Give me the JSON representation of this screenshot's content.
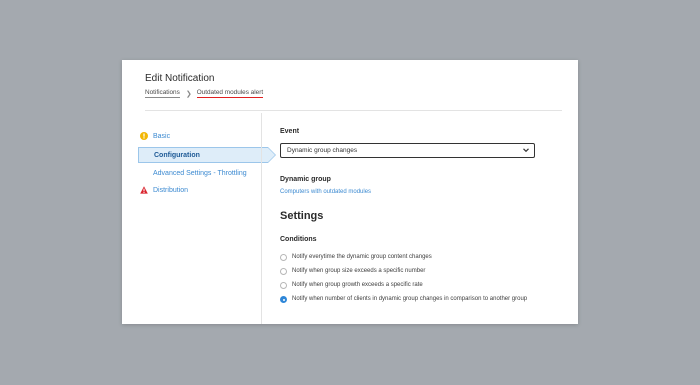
{
  "dialog": {
    "title": "Edit Notification",
    "breadcrumb": {
      "parent": "Notifications",
      "current": "Outdated modules alert"
    }
  },
  "sidebar": {
    "items": [
      {
        "label": "Basic",
        "icon": "warning-circle-icon",
        "icon_color": "#f2b705"
      },
      {
        "label": "Configuration",
        "active": true
      },
      {
        "label": "Advanced Settings - Throttling"
      },
      {
        "label": "Distribution",
        "icon": "error-triangle-icon",
        "icon_color": "#d9232d"
      }
    ]
  },
  "main": {
    "event_label": "Event",
    "event_select_value": "Dynamic group changes",
    "dynamic_group_label": "Dynamic group",
    "dynamic_group_value": "Computers with outdated modules",
    "settings_heading": "Settings",
    "conditions_label": "Conditions",
    "conditions": [
      {
        "label": "Notify everytime the dynamic group content changes",
        "checked": false
      },
      {
        "label": "Notify when group size exceeds a specific number",
        "checked": false
      },
      {
        "label": "Notify when group growth exceeds a specific rate",
        "checked": false
      },
      {
        "label": "Notify when number of clients in dynamic group changes in comparison to another group",
        "checked": true
      }
    ]
  },
  "colors": {
    "accent": "#3c8ad1",
    "active_bg": "#deedf9",
    "breadcrumb_underline": "#e02020"
  }
}
